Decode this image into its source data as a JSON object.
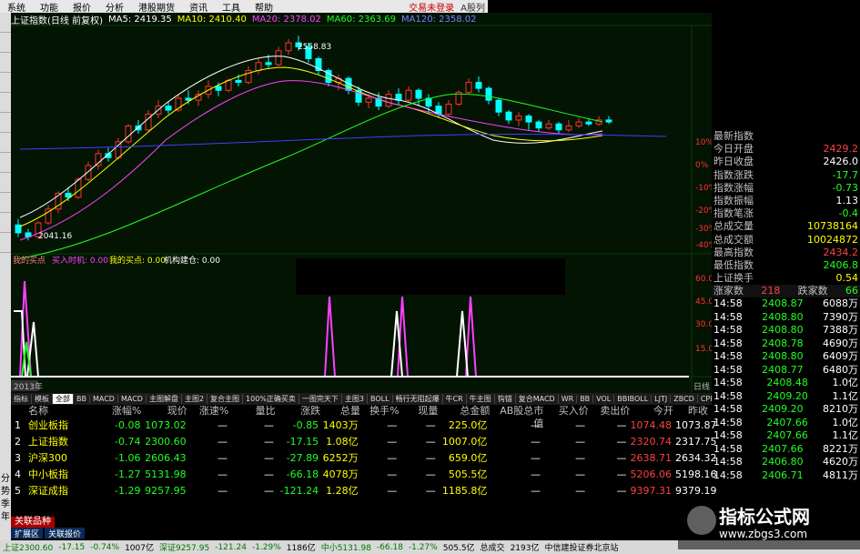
{
  "menu": {
    "items": [
      "系统",
      "功能",
      "报价",
      "分析",
      "港股期货",
      "资讯",
      "工具",
      "帮助"
    ],
    "login": "交易未登录",
    "brand": "A股列"
  },
  "chart": {
    "header": "上证指数(日线 前复权)",
    "ma5": "MA5: 2419.35",
    "ma10": "MA10: 2410.40",
    "ma20": "MA20: 2378.02",
    "ma60": "MA60: 2363.69",
    "ma120": "MA120: 2358.02",
    "high_label": "2558.83",
    "low_label": "2041.16",
    "pct_labels": [
      "10%",
      "0%",
      "-10%",
      "-20%",
      "-30%",
      "-40%"
    ],
    "indicator_title": "我的买点",
    "ind_buy_signal": "买入时机: 0.00",
    "ind_my_buy": "我的买点: 0.00",
    "ind_inst": "机构建仓: 0.00",
    "ind_levels": [
      "60.00",
      "45.00",
      "30.00",
      "15.00"
    ],
    "year_label": "2013年",
    "period_label": "日线",
    "bars": [
      {
        "o": 2080,
        "c": 2060,
        "h": 2095,
        "l": 2050
      },
      {
        "o": 2060,
        "c": 2050,
        "h": 2070,
        "l": 2041
      },
      {
        "o": 2050,
        "c": 2085,
        "h": 2090,
        "l": 2045
      },
      {
        "o": 2085,
        "c": 2120,
        "h": 2130,
        "l": 2080
      },
      {
        "o": 2120,
        "c": 2160,
        "h": 2165,
        "l": 2110
      },
      {
        "o": 2160,
        "c": 2150,
        "h": 2175,
        "l": 2140
      },
      {
        "o": 2150,
        "c": 2195,
        "h": 2200,
        "l": 2145
      },
      {
        "o": 2195,
        "c": 2230,
        "h": 2240,
        "l": 2190
      },
      {
        "o": 2230,
        "c": 2260,
        "h": 2270,
        "l": 2220
      },
      {
        "o": 2260,
        "c": 2250,
        "h": 2275,
        "l": 2240
      },
      {
        "o": 2250,
        "c": 2290,
        "h": 2300,
        "l": 2245
      },
      {
        "o": 2290,
        "c": 2330,
        "h": 2335,
        "l": 2285
      },
      {
        "o": 2330,
        "c": 2320,
        "h": 2345,
        "l": 2310
      },
      {
        "o": 2320,
        "c": 2360,
        "h": 2370,
        "l": 2315
      },
      {
        "o": 2360,
        "c": 2380,
        "h": 2395,
        "l": 2350
      },
      {
        "o": 2380,
        "c": 2370,
        "h": 2390,
        "l": 2360
      },
      {
        "o": 2370,
        "c": 2400,
        "h": 2410,
        "l": 2365
      },
      {
        "o": 2400,
        "c": 2395,
        "h": 2420,
        "l": 2385
      },
      {
        "o": 2395,
        "c": 2410,
        "h": 2420,
        "l": 2380
      },
      {
        "o": 2410,
        "c": 2430,
        "h": 2445,
        "l": 2400
      },
      {
        "o": 2430,
        "c": 2420,
        "h": 2440,
        "l": 2405
      },
      {
        "o": 2420,
        "c": 2445,
        "h": 2450,
        "l": 2415
      },
      {
        "o": 2445,
        "c": 2440,
        "h": 2460,
        "l": 2430
      },
      {
        "o": 2440,
        "c": 2470,
        "h": 2480,
        "l": 2435
      },
      {
        "o": 2470,
        "c": 2490,
        "h": 2500,
        "l": 2460
      },
      {
        "o": 2490,
        "c": 2485,
        "h": 2510,
        "l": 2475
      },
      {
        "o": 2485,
        "c": 2520,
        "h": 2530,
        "l": 2480
      },
      {
        "o": 2520,
        "c": 2540,
        "h": 2550,
        "l": 2510
      },
      {
        "o": 2540,
        "c": 2530,
        "h": 2558,
        "l": 2520
      },
      {
        "o": 2530,
        "c": 2500,
        "h": 2540,
        "l": 2490
      },
      {
        "o": 2500,
        "c": 2470,
        "h": 2505,
        "l": 2460
      },
      {
        "o": 2470,
        "c": 2440,
        "h": 2475,
        "l": 2430
      },
      {
        "o": 2440,
        "c": 2450,
        "h": 2460,
        "l": 2420
      },
      {
        "o": 2450,
        "c": 2420,
        "h": 2455,
        "l": 2410
      },
      {
        "o": 2420,
        "c": 2390,
        "h": 2430,
        "l": 2380
      },
      {
        "o": 2390,
        "c": 2400,
        "h": 2410,
        "l": 2375
      },
      {
        "o": 2400,
        "c": 2380,
        "h": 2415,
        "l": 2370
      },
      {
        "o": 2380,
        "c": 2410,
        "h": 2420,
        "l": 2375
      },
      {
        "o": 2410,
        "c": 2395,
        "h": 2425,
        "l": 2385
      },
      {
        "o": 2395,
        "c": 2420,
        "h": 2430,
        "l": 2390
      },
      {
        "o": 2420,
        "c": 2400,
        "h": 2425,
        "l": 2380
      },
      {
        "o": 2400,
        "c": 2380,
        "h": 2410,
        "l": 2360
      },
      {
        "o": 2380,
        "c": 2360,
        "h": 2390,
        "l": 2350
      },
      {
        "o": 2360,
        "c": 2385,
        "h": 2395,
        "l": 2355
      },
      {
        "o": 2385,
        "c": 2415,
        "h": 2420,
        "l": 2380
      },
      {
        "o": 2415,
        "c": 2440,
        "h": 2450,
        "l": 2410
      },
      {
        "o": 2440,
        "c": 2425,
        "h": 2455,
        "l": 2415
      },
      {
        "o": 2425,
        "c": 2395,
        "h": 2430,
        "l": 2385
      },
      {
        "o": 2395,
        "c": 2365,
        "h": 2400,
        "l": 2355
      },
      {
        "o": 2365,
        "c": 2345,
        "h": 2370,
        "l": 2335
      },
      {
        "o": 2345,
        "c": 2355,
        "h": 2365,
        "l": 2330
      },
      {
        "o": 2355,
        "c": 2340,
        "h": 2360,
        "l": 2320
      },
      {
        "o": 2340,
        "c": 2325,
        "h": 2345,
        "l": 2315
      },
      {
        "o": 2325,
        "c": 2335,
        "h": 2345,
        "l": 2320
      },
      {
        "o": 2335,
        "c": 2320,
        "h": 2340,
        "l": 2310
      },
      {
        "o": 2320,
        "c": 2330,
        "h": 2345,
        "l": 2315
      },
      {
        "o": 2330,
        "c": 2340,
        "h": 2350,
        "l": 2325
      },
      {
        "o": 2340,
        "c": 2335,
        "h": 2350,
        "l": 2330
      },
      {
        "o": 2335,
        "c": 2345,
        "h": 2355,
        "l": 2330
      },
      {
        "o": 2345,
        "c": 2340,
        "h": 2355,
        "l": 2335
      }
    ]
  },
  "info": {
    "rows": [
      {
        "label": "最新指数",
        "value": "",
        "color": "#ff4040"
      },
      {
        "label": "今日开盘",
        "value": "2429.2",
        "color": "#ff4040"
      },
      {
        "label": "昨日收盘",
        "value": "2426.0",
        "color": "#ffffff"
      },
      {
        "label": "指数涨跌",
        "value": "-17.7",
        "color": "#20ff20"
      },
      {
        "label": "指数涨幅",
        "value": "-0.73",
        "color": "#20ff20"
      },
      {
        "label": "指数振幅",
        "value": "1.13",
        "color": "#ffffff"
      },
      {
        "label": "指数笔涨",
        "value": "-0.4",
        "color": "#20ff20"
      },
      {
        "label": "总成交量",
        "value": "10738164",
        "color": "#ffff00"
      },
      {
        "label": "总成交额",
        "value": "10024872",
        "color": "#ffff00"
      },
      {
        "label": "最高指数",
        "value": "2434.2",
        "color": "#ff4040"
      },
      {
        "label": "最低指数",
        "value": "2406.8",
        "color": "#20ff20"
      },
      {
        "label": "上证换手",
        "value": "0.54",
        "color": "#ffff00"
      }
    ],
    "rise_label": "涨家数",
    "rise_value": "218",
    "fall_label": "跌家数",
    "fall_value": "66",
    "ticks": [
      {
        "time": "14:58",
        "price": "2408.87",
        "vol": "6088万"
      },
      {
        "time": "14:58",
        "price": "2408.80",
        "vol": "7390万"
      },
      {
        "time": "14:58",
        "price": "2408.80",
        "vol": "7388万"
      },
      {
        "time": "14:58",
        "price": "2408.78",
        "vol": "4690万"
      },
      {
        "time": "14:58",
        "price": "2408.80",
        "vol": "6409万"
      },
      {
        "time": "14:58",
        "price": "2408.77",
        "vol": "6480万"
      },
      {
        "time": "14:58",
        "price": "2408.48",
        "vol": "1.0亿"
      },
      {
        "time": "14:58",
        "price": "2409.20",
        "vol": "1.1亿"
      },
      {
        "time": "14:58",
        "price": "2409.20",
        "vol": "8210万"
      },
      {
        "time": "14:58",
        "price": "2407.66",
        "vol": "1.0亿"
      },
      {
        "time": "14:58",
        "price": "2407.66",
        "vol": "1.1亿"
      },
      {
        "time": "14:58",
        "price": "2407.66",
        "vol": "8221万"
      },
      {
        "time": "14:58",
        "price": "2406.80",
        "vol": "4620万"
      },
      {
        "time": "14:58",
        "price": "2406.71",
        "vol": "4811万"
      }
    ]
  },
  "tabs": [
    "指标",
    "模板",
    "全部",
    "BB",
    "MACD",
    "MACD",
    "主图解盘",
    "主图2",
    "复合主图",
    "100%正确买卖",
    "一图完天下",
    "主图3",
    "BOLL",
    "畅行无阻起爆",
    "牛CR",
    "牛主图",
    "钩锚",
    "复合MACD",
    "WR",
    "BB",
    "VOL",
    "BBIBOLL",
    "LJTJ",
    "ZBCD",
    "CPRS",
    "DDX"
  ],
  "table": {
    "headers": [
      "",
      "名称",
      "涨幅%",
      "现价",
      "涨速%",
      "量比",
      "涨跌",
      "总量",
      "换手%",
      "现量",
      "总金额",
      "AB股总市值",
      "买入价",
      "卖出价",
      "今开",
      "昨收"
    ],
    "rows": [
      [
        "1",
        "创业板指",
        "-0.08",
        "1073.02",
        "—",
        "—",
        "-0.85",
        "1403万",
        "—",
        "—",
        "225.0亿",
        "—",
        "—",
        "—",
        "1074.48",
        "1073.87"
      ],
      [
        "2",
        "上证指数",
        "-0.74",
        "2300.60",
        "—",
        "—",
        "-17.15",
        "1.08亿",
        "—",
        "—",
        "1007.0亿",
        "—",
        "—",
        "—",
        "2320.74",
        "2317.75"
      ],
      [
        "3",
        "沪深300",
        "-1.06",
        "2606.43",
        "—",
        "—",
        "-27.89",
        "6252万",
        "—",
        "—",
        "659.0亿",
        "—",
        "—",
        "—",
        "2638.71",
        "2634.32"
      ],
      [
        "4",
        "中小板指",
        "-1.27",
        "5131.98",
        "—",
        "—",
        "-66.18",
        "4078万",
        "—",
        "—",
        "505.5亿",
        "—",
        "—",
        "—",
        "5206.06",
        "5198.16"
      ],
      [
        "5",
        "深证成指",
        "-1.29",
        "9257.95",
        "—",
        "—",
        "-121.24",
        "1.28亿",
        "—",
        "—",
        "1185.8亿",
        "—",
        "—",
        "—",
        "9397.31",
        "9379.19"
      ]
    ]
  },
  "related": "关联品种",
  "bottom_tabs": [
    "扩展区",
    "关联报价"
  ],
  "left_nav": [
    "分",
    "势",
    "季",
    "年"
  ],
  "status": [
    {
      "t": "上证2300.60",
      "c": "dn"
    },
    {
      "t": "-17.15",
      "c": "dn"
    },
    {
      "t": "-0.74%",
      "c": "dn"
    },
    {
      "t": "1007亿",
      "c": ""
    },
    {
      "t": "深证9257.95",
      "c": "dn"
    },
    {
      "t": "-121.24",
      "c": "dn"
    },
    {
      "t": "-1.29%",
      "c": "dn"
    },
    {
      "t": "1186亿",
      "c": ""
    },
    {
      "t": "中小5131.98",
      "c": "dn"
    },
    {
      "t": "-66.18",
      "c": "dn"
    },
    {
      "t": "-1.27%",
      "c": "dn"
    },
    {
      "t": "505.5亿",
      "c": ""
    },
    {
      "t": "总成交",
      "c": ""
    },
    {
      "t": "2193亿",
      "c": ""
    },
    {
      "t": "中信建投证券北京站",
      "c": ""
    }
  ],
  "watermark": {
    "title": "指标公式网",
    "url": "www.zbgs3.com"
  }
}
